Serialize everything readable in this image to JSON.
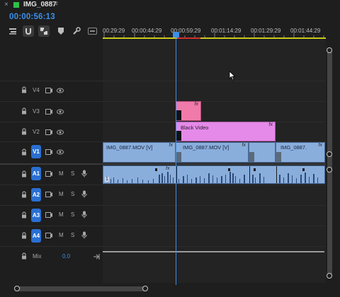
{
  "tab": {
    "close_glyph": "×",
    "title": "IMG_0887",
    "menu_glyph": "≡",
    "swatch_color": "#2fbf4a"
  },
  "timecode": "00:00:56:13",
  "toolbar": {
    "tools": [
      "insert-overwrite-icon",
      "snap-icon",
      "linked-selection-icon",
      "add-marker-icon",
      "settings-wrench-icon",
      "captions-icon"
    ]
  },
  "ruler": {
    "labels": [
      "00:29:29",
      "00:00:44:29",
      "00:00:59:29",
      "00:01:14:29",
      "00:01:29:29",
      "00:01:44:29"
    ]
  },
  "video_tracks": [
    {
      "name": "V4"
    },
    {
      "name": "V3"
    },
    {
      "name": "V2"
    },
    {
      "name": "V1",
      "targeted": true
    }
  ],
  "audio_tracks": [
    {
      "name": "A1",
      "targeted": true,
      "m": "M",
      "s": "S"
    },
    {
      "name": "A2",
      "targeted": true,
      "m": "M",
      "s": "S"
    },
    {
      "name": "A3",
      "targeted": true,
      "m": "M",
      "s": "S"
    },
    {
      "name": "A4",
      "targeted": true,
      "m": "M",
      "s": "S"
    }
  ],
  "mix": {
    "label": "Mix",
    "value": "0.0"
  },
  "clips": {
    "v3_fx": "fx",
    "black_video": {
      "label": "Black Video",
      "fx": "fx"
    },
    "v1": [
      {
        "label": "IMG_0887.MOV [V]",
        "fx": "fx"
      },
      {
        "label": "IMG_0887.MOV [V]",
        "fx": "fx"
      },
      {
        "label": "",
        "fx": ""
      },
      {
        "label": "IMG_0887.",
        "fx": "fx"
      }
    ],
    "a1_marker": "1",
    "a1_fx": "fx"
  },
  "colors": {
    "accent": "#3d8ee8",
    "v3_clip": "#f07aaa",
    "black_video_clip": "#e58ae8",
    "video_clip": "#8aaedc",
    "in_out_bar": "#c8c81e"
  }
}
